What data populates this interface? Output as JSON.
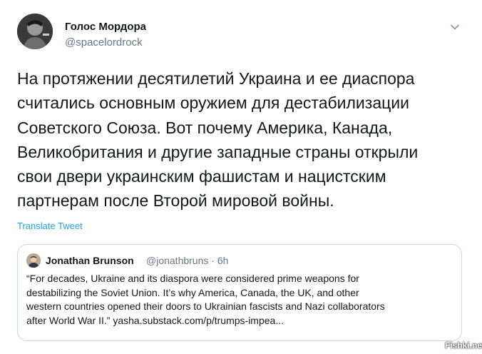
{
  "tweet": {
    "author_name": "Голос Мордора",
    "author_handle": "@spacelordrock",
    "avatar_icon": "user-avatar-icon",
    "caret_icon": "chevron-down-icon",
    "text": "На протяжении десятилетий Украина и ее диаспора\nсчитались основным оружием для дестабилизации\nСоветского Союза. Вот почему Америка, Канада,\nВеликобритания и другие западные страны открыли\nсвои двери украинским фашистам и нацистским\nпартнерам после Второй мировой войны.",
    "translate_label": "Translate Tweet",
    "link_color": "#1da1f2"
  },
  "quoted_tweet": {
    "author_name": "Jonathan Brunson",
    "author_handle_time": "@jonathbruns · 6h",
    "text": "“For decades, Ukraine and its diaspora were considered prime weapons for\ndestabilizing the Soviet Union. It’s why America, Canada, the UK, and other\nwestern countries opened their doors to Ukrainian fascists and Nazi collaborators\nafter World War II.” yasha.substack.com/p/trumps-impea..."
  },
  "watermark": "Fishki.net"
}
